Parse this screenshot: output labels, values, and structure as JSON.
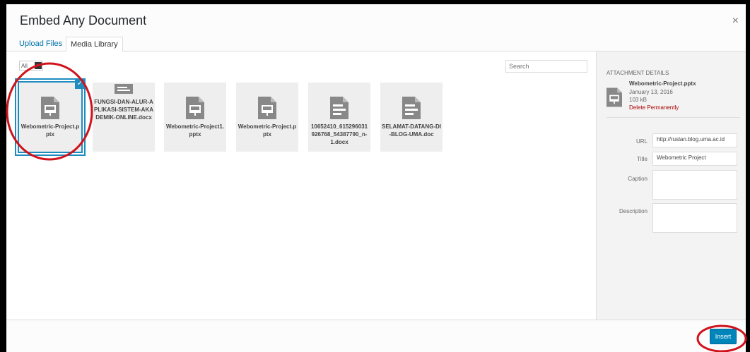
{
  "modal": {
    "title": "Embed Any Document",
    "close": "×"
  },
  "tabs": [
    {
      "label": "Upload Files"
    },
    {
      "label": "Media Library"
    }
  ],
  "toolbar": {
    "filter_value": "All",
    "filter_arrow": "▾",
    "search_placeholder": "Search"
  },
  "items": [
    {
      "name": "Webometric-Project.pptx",
      "type": "presentation"
    },
    {
      "name": "FUNGSI-DAN-ALUR-APLIKASI-SISTEM-AKADEMIK-ONLINE.docx",
      "type": "document"
    },
    {
      "name": "Webometric-Project1.pptx",
      "type": "presentation"
    },
    {
      "name": "Webometric-Project.pptx",
      "type": "presentation"
    },
    {
      "name": "10652410_615296031926768_54387790_n-1.docx",
      "type": "document"
    },
    {
      "name": "SELAMAT-DATANG-DI-BLOG-UMA.doc",
      "type": "document"
    }
  ],
  "check_mark": "✓",
  "attachment": {
    "heading": "ATTACHMENT DETAILS",
    "filename": "Webometric-Project.pptx",
    "date": "January 13, 2016",
    "size": "103 kB",
    "delete_label": "Delete Permanently",
    "url_label": "URL",
    "url_value": "http://ruslan.blog.uma.ac.id",
    "title_label": "Title",
    "title_value": "Webometric Project",
    "caption_label": "Caption",
    "caption_value": "",
    "description_label": "Description",
    "description_value": ""
  },
  "footer": {
    "insert_label": "Insert"
  },
  "colors": {
    "accent": "#0085ba",
    "selection": "#1e8cbe",
    "annotation": "#d0121b",
    "delete": "#a00"
  }
}
